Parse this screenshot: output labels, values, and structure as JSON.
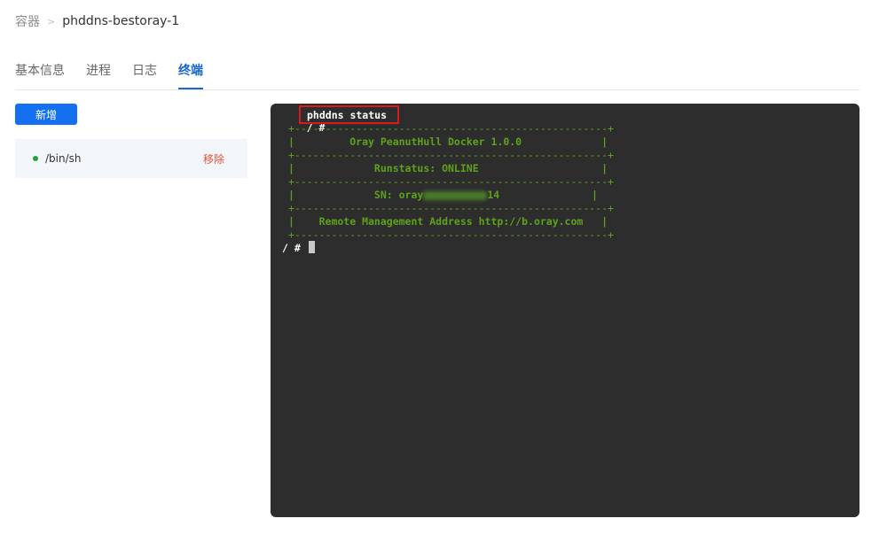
{
  "breadcrumb": {
    "root": "容器",
    "separator": ">",
    "current": "phddns-bestoray-1"
  },
  "tabs": [
    {
      "label": "基本信息",
      "active": false
    },
    {
      "label": "进程",
      "active": false
    },
    {
      "label": "日志",
      "active": false
    },
    {
      "label": "终端",
      "active": true
    }
  ],
  "add_button_label": "新增",
  "sessions": [
    {
      "name": "/bin/sh",
      "remove_label": "移除",
      "status_color": "#21a336"
    }
  ],
  "terminal": {
    "prompt": "/ #",
    "command": "phddns status",
    "border_line": "+---------------------------------------------------+",
    "rows": [
      {
        "text": "|         Oray PeanutHull Docker 1.0.0             |"
      },
      {
        "text": "|             Runstatus: ONLINE                    |"
      },
      {
        "sn_prefix": "|             SN: oray",
        "sn_suffix": "14               |"
      },
      {
        "text": "|    Remote Management Address http://b.oray.com   |"
      }
    ],
    "colors": {
      "background": "#2d2d2d",
      "output": "#5ea21b",
      "highlight_border": "#d51b1b"
    }
  },
  "colors": {
    "accent": "#1470f0",
    "danger": "#e0553a"
  }
}
